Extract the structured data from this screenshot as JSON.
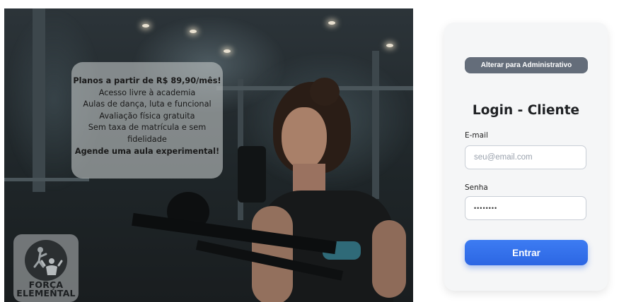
{
  "promo": {
    "headline": "Planos a partir de R$ 89,90/mês!",
    "lines": [
      "Acesso livre à academia",
      "Aulas de dança, luta e funcional",
      "Avaliação física gratuita",
      "Sem taxa de matrícula e sem",
      "fidelidade"
    ],
    "cta": "Agende uma aula experimental!"
  },
  "logo": {
    "line1": "FORÇA",
    "line2": "ELEMENTAL"
  },
  "login": {
    "switch_label": "Alterar para Administrativo",
    "title": "Login - Cliente",
    "email_label": "E-mail",
    "email_placeholder": "seu@email.com",
    "email_value": "",
    "password_label": "Senha",
    "password_value": "••••••••",
    "submit_label": "Entrar"
  },
  "colors": {
    "switch_button": "#646d7a",
    "submit_button": "#2c66e3",
    "card_background": "#f5f6f7"
  }
}
